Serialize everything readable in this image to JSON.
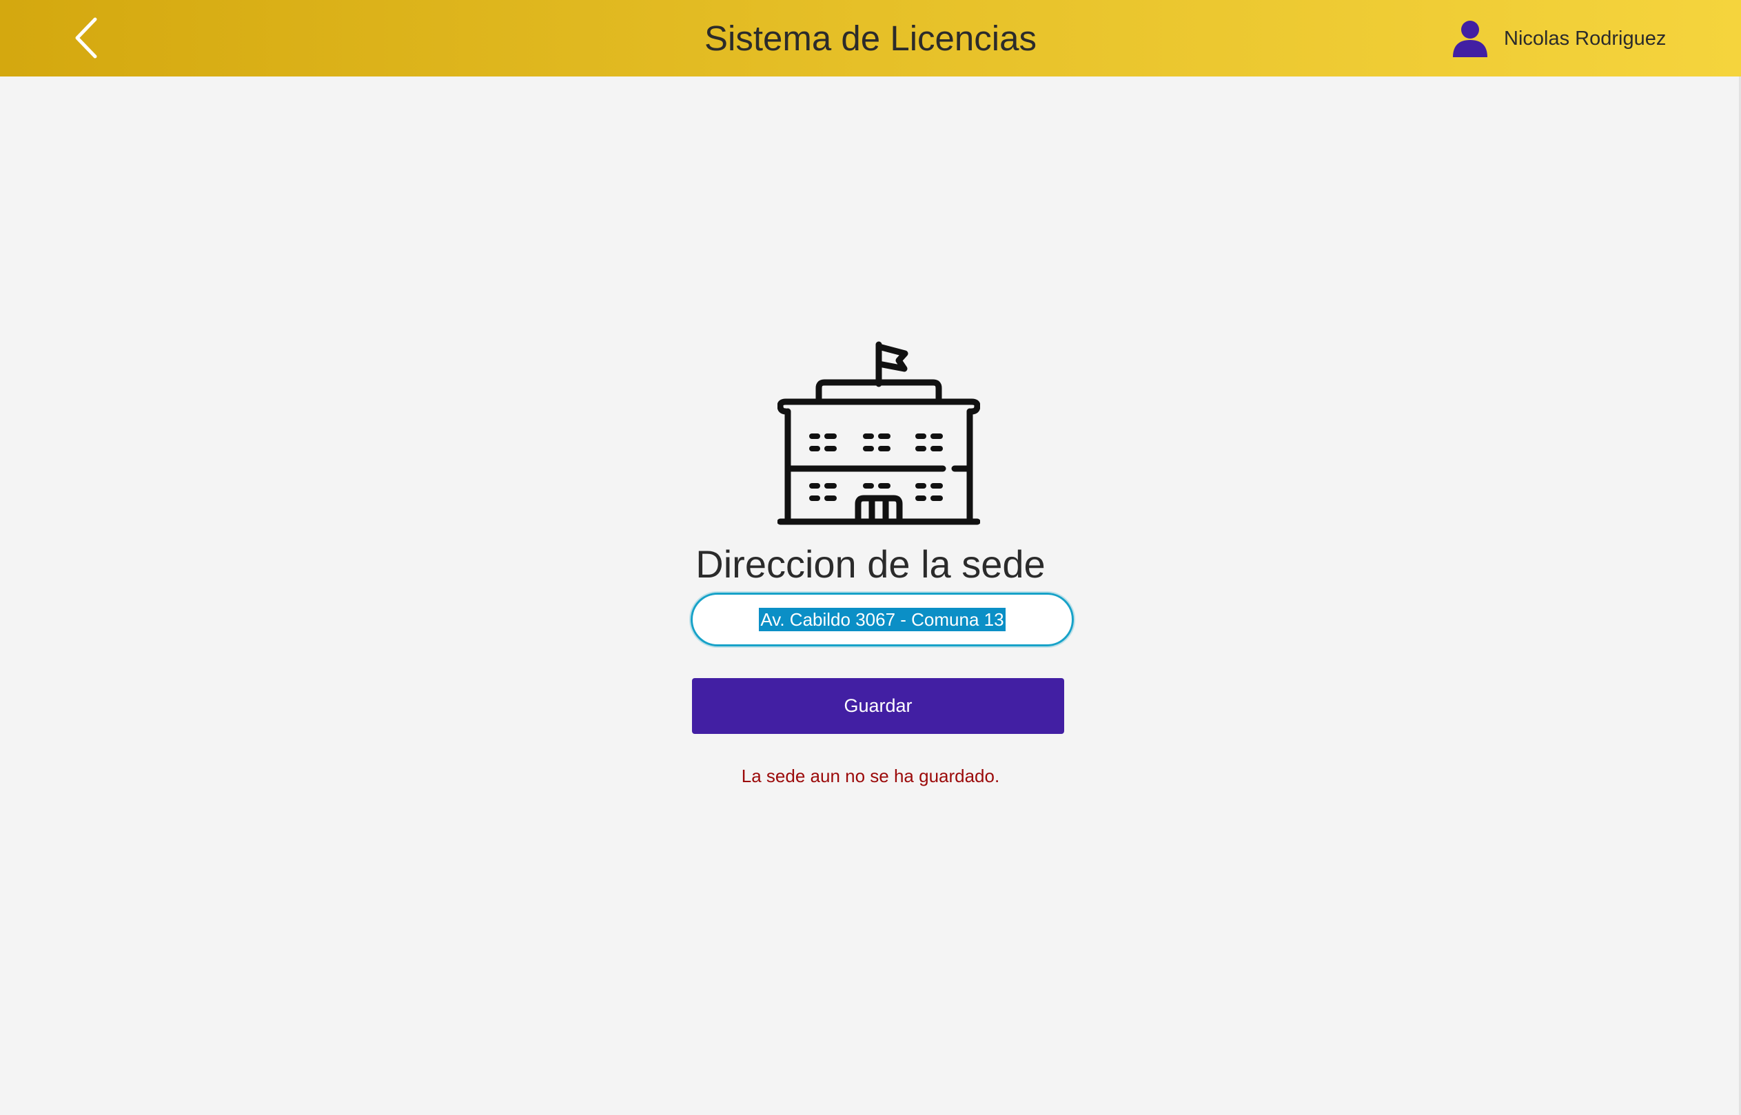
{
  "header": {
    "title": "Sistema de Licencias",
    "user_name": "Nicolas Rodriguez",
    "background_start": "#d4a80f",
    "background_end": "#f5d43d",
    "back_icon": "chevron-left-icon",
    "user_icon": "person-icon",
    "user_icon_color": "#421fa3"
  },
  "main": {
    "icon": "building-icon",
    "section_title": "Direccion de la sede",
    "address_value": "Av. Cabildo 3067 - Comuna 13",
    "save_label": "Guardar",
    "status_message": "La sede aun no se ha guardado.",
    "accent_color": "#421fa3",
    "status_color": "#9b0a0a",
    "input_border_color": "#17a2c8"
  }
}
